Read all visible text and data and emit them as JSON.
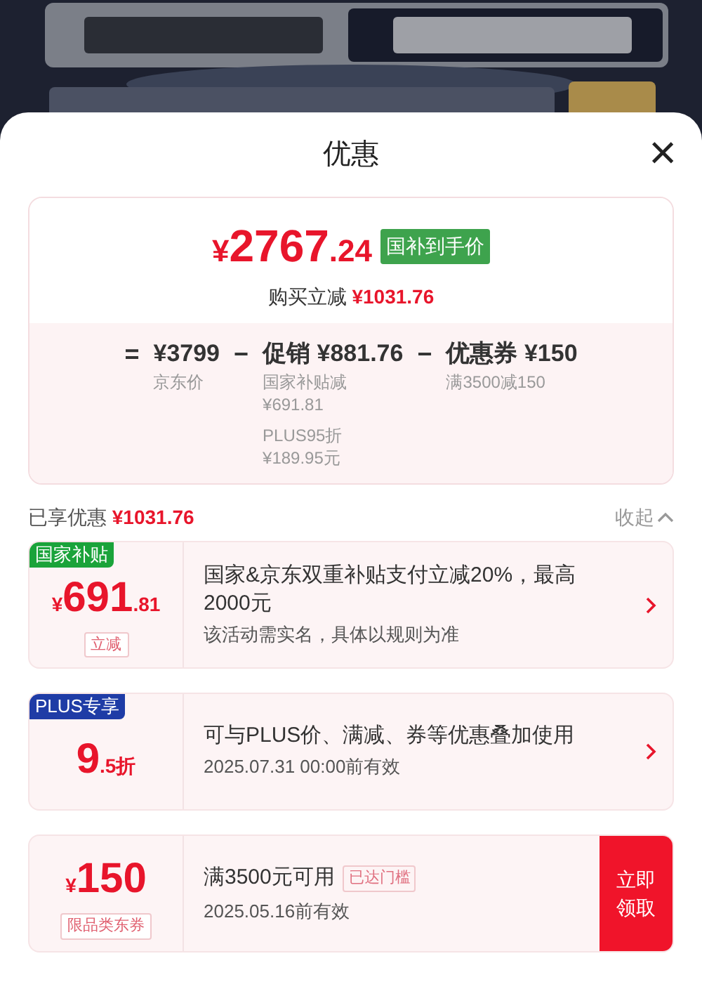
{
  "sheet": {
    "title": "优惠",
    "close": "×"
  },
  "summary": {
    "currency": "¥",
    "price_whole": "2767",
    "price_fraction": ".24",
    "price_tag": "国补到手价",
    "saving_label": "购买立减",
    "saving_amount": "¥1031.76",
    "formula": [
      {
        "kind": "operator",
        "text": "="
      },
      {
        "kind": "term",
        "amount": "¥3799",
        "notes": [
          "京东价"
        ]
      },
      {
        "kind": "operator",
        "text": "−"
      },
      {
        "kind": "term",
        "label": "促销",
        "amount": "¥881.76",
        "notes": [
          "国家补贴减\n¥691.81",
          "PLUS95折\n¥189.95元"
        ]
      },
      {
        "kind": "operator",
        "text": "−"
      },
      {
        "kind": "term",
        "label": "优惠券",
        "amount": "¥150",
        "notes": [
          "满3500减150"
        ]
      }
    ]
  },
  "enjoyed": {
    "label": "已享优惠",
    "amount": "¥1031.76",
    "toggle": "收起",
    "expanded": true
  },
  "offers": [
    {
      "kind": "subsidy",
      "tag": "国家补贴",
      "color": "#1aa33a",
      "prefix": "¥",
      "big": "691",
      "small": ".81",
      "badge": "立减",
      "lines": [
        "国家&京东双重补贴支付立减20%，最高2000元",
        "该活动需实名，具体以规则为准"
      ]
    },
    {
      "kind": "plus",
      "tag": "PLUS专享",
      "color": "#1f3ca6",
      "big": "9",
      "small": ".5折",
      "lines": [
        "可与PLUS价、满减、券等优惠叠加使用",
        "2025.07.31 00:00前有效"
      ]
    },
    {
      "kind": "coupon",
      "prefix": "¥",
      "big": "150",
      "badge": "限品类东券",
      "lines": [
        "满3500元可用",
        "2025.05.16前有效"
      ],
      "condition": "已达门槛",
      "action": "立即领取"
    }
  ]
}
